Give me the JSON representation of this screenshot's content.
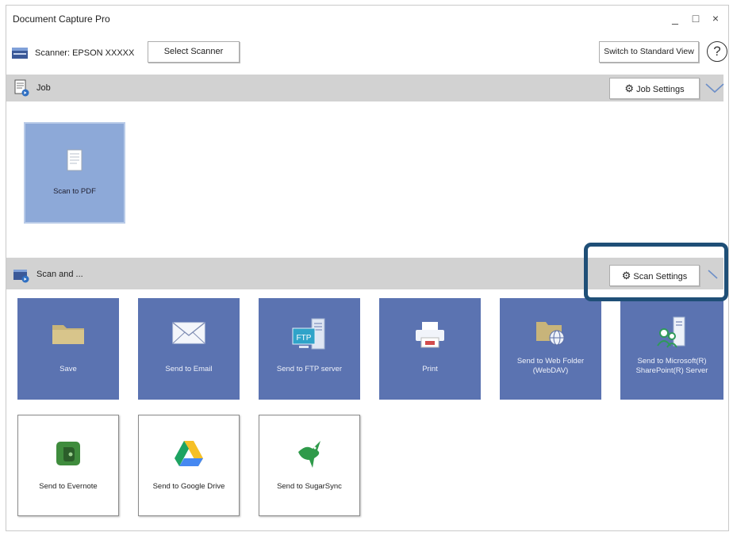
{
  "window": {
    "title": "Document Capture Pro",
    "controls": [
      "_",
      "□",
      "×"
    ]
  },
  "toolbar": {
    "scanner_label": "Scanner: EPSON XXXXX",
    "select_scanner_label": "Select Scanner",
    "switch_view_label": "Switch to Standard View",
    "help_label": "?"
  },
  "job_section": {
    "label": "Job",
    "settings_label": "Job Settings",
    "tiles": [
      {
        "label": "Scan to PDF",
        "icon": "document-icon"
      }
    ]
  },
  "scan_section": {
    "label": "Scan and ...",
    "settings_label": "Scan Settings",
    "tiles": [
      {
        "label": "Save",
        "icon": "folder-icon"
      },
      {
        "label": "Send to Email",
        "icon": "envelope-icon"
      },
      {
        "label": "Send to FTP server",
        "icon": "ftp-server-icon"
      },
      {
        "label": "Print",
        "icon": "printer-icon"
      },
      {
        "label": "Send to Web Folder (WebDAV)",
        "icon": "web-folder-icon"
      },
      {
        "label": "Send to Microsoft(R) SharePoint(R) Server",
        "icon": "sharepoint-icon"
      },
      {
        "label": "Send to Evernote",
        "icon": "evernote-icon"
      },
      {
        "label": "Send to Google Drive",
        "icon": "google-drive-icon"
      },
      {
        "label": "Send to SugarSync",
        "icon": "sugarsync-icon"
      }
    ]
  },
  "colors": {
    "tile_blue": "#5b73b1",
    "tile_selected": "#8da9d8",
    "section_bar": "#d2d2d2",
    "highlight": "#1f4f77"
  }
}
